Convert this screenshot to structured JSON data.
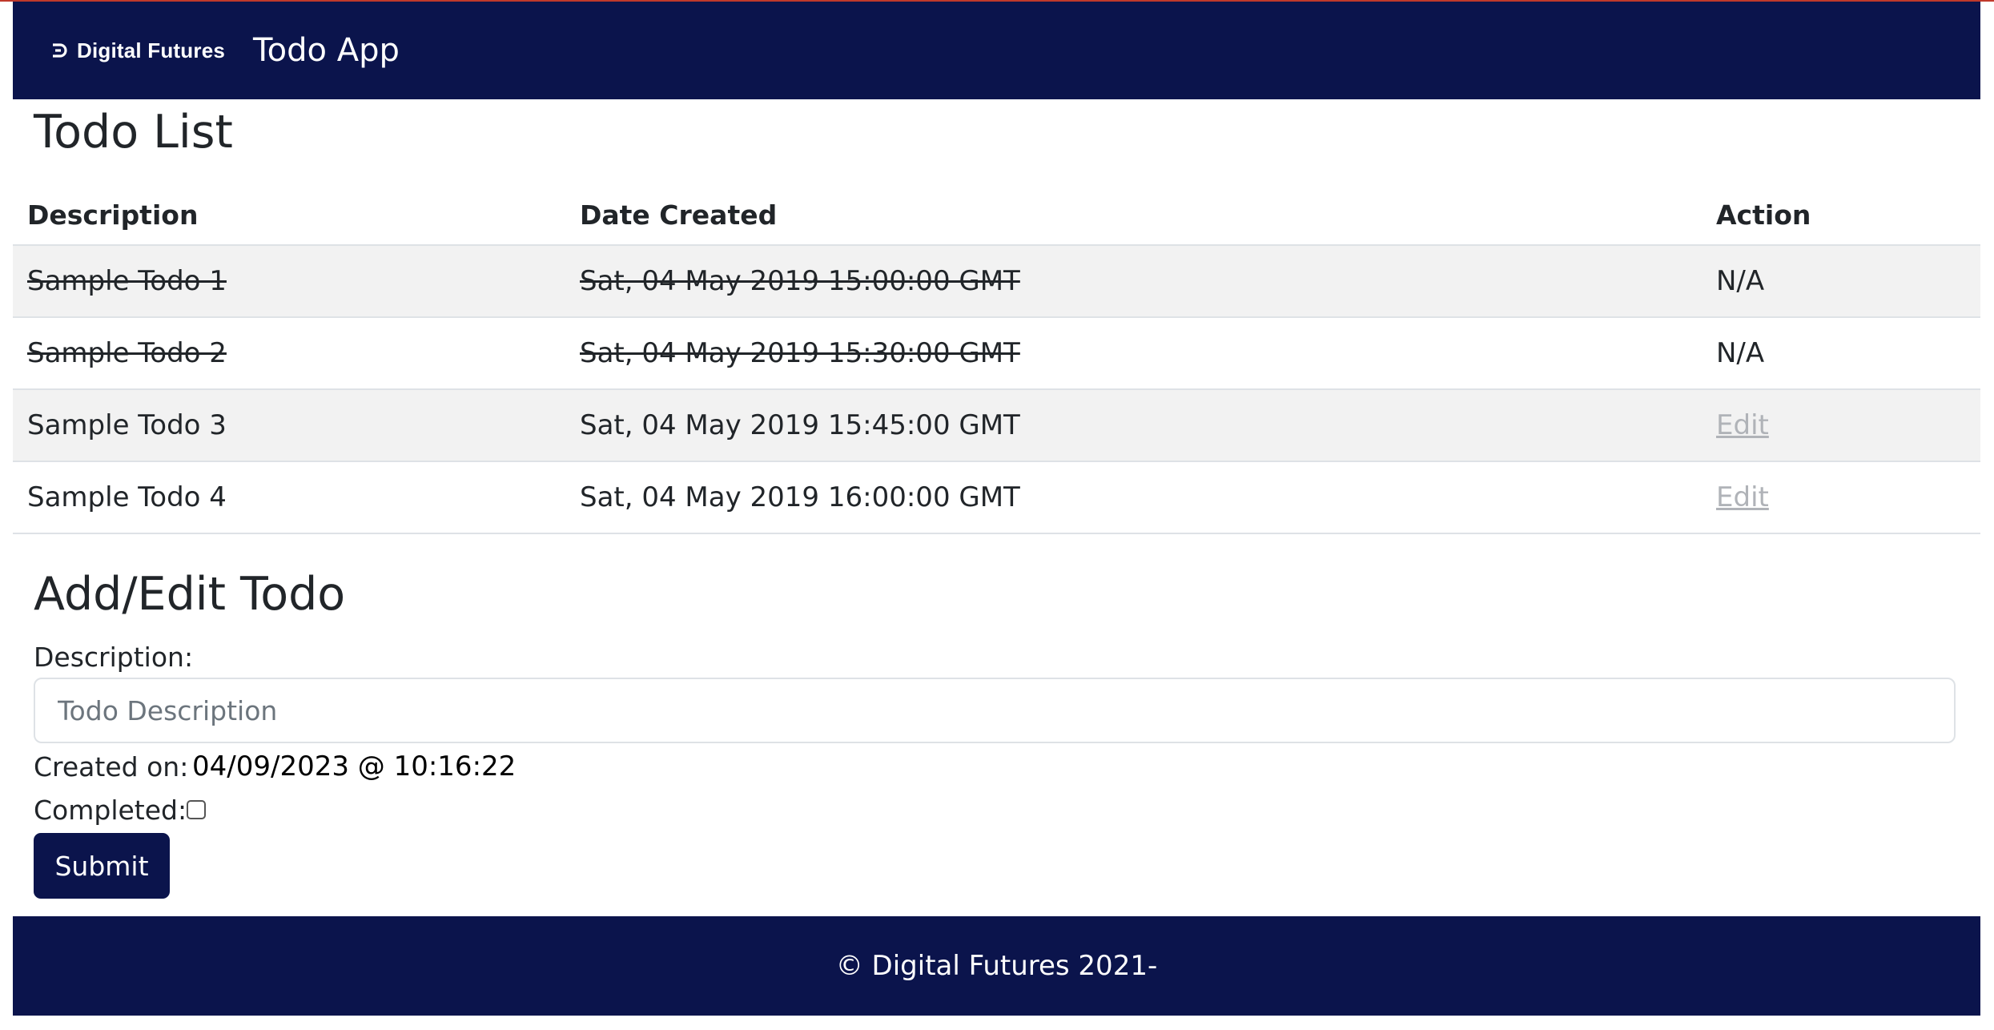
{
  "navbar": {
    "brand": "Digital Futures",
    "brand_icon": "digital-futures-logo-icon",
    "app_title": "Todo App",
    "background": "#0b144c"
  },
  "todo_list": {
    "title": "Todo List",
    "headers": [
      "Description",
      "Date Created",
      "Action"
    ],
    "rows": [
      {
        "description": "Sample Todo 1",
        "date": "Sat, 04 May 2019 15:00:00 GMT",
        "action": "N/A",
        "completed": true
      },
      {
        "description": "Sample Todo 2",
        "date": "Sat, 04 May 2019 15:30:00 GMT",
        "action": "N/A",
        "completed": true
      },
      {
        "description": "Sample Todo 3",
        "date": "Sat, 04 May 2019 15:45:00 GMT",
        "action": "Edit",
        "completed": false
      },
      {
        "description": "Sample Todo 4",
        "date": "Sat, 04 May 2019 16:00:00 GMT",
        "action": "Edit",
        "completed": false
      }
    ]
  },
  "form": {
    "title": "Add/Edit Todo",
    "description_label": "Description:",
    "description_value": "",
    "description_placeholder": "Todo Description",
    "created_label": "Created on:",
    "created_value": "04/09/2023 @ 10:16:22",
    "completed_label": "Completed:",
    "completed_checked": false,
    "submit_label": "Submit"
  },
  "footer": {
    "text": "© Digital Futures 2021-"
  }
}
